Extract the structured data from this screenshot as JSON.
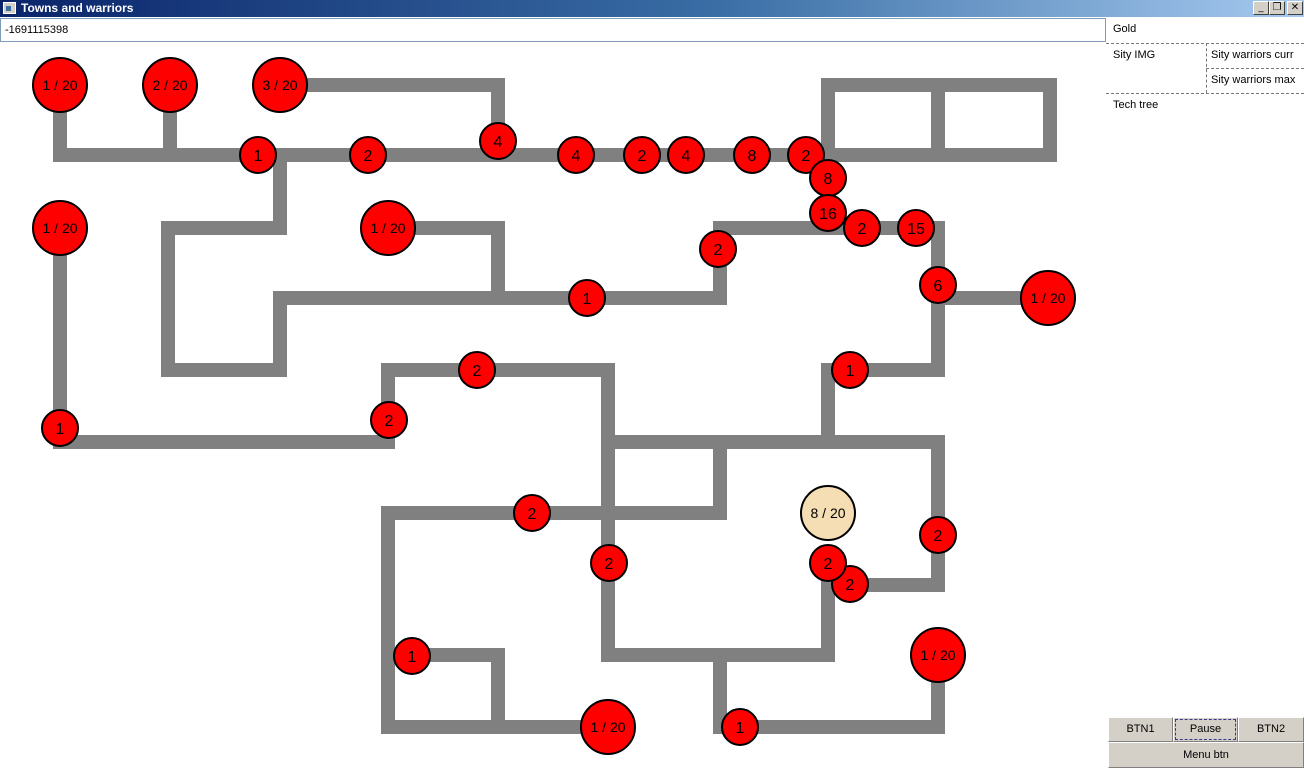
{
  "window": {
    "title": "Towns and warriors"
  },
  "seed_field": {
    "value": "-1691115398"
  },
  "side_panel": {
    "gold_label": "Gold",
    "city_img_label": "Sity IMG",
    "warriors_curr_label": "Sity warriors curr",
    "warriors_max_label": "Sity warriors max",
    "tech_tree_label": "Tech tree",
    "buttons": {
      "btn1": "BTN1",
      "pause": "Pause",
      "btn2": "BTN2",
      "menu": "Menu btn"
    }
  },
  "colors": {
    "enemy": "#ff0000",
    "player": "#f5deb3",
    "road": "#808080"
  },
  "cities": [
    {
      "label": "1 / 20",
      "owner": "enemy"
    },
    {
      "label": "2 / 20",
      "owner": "enemy"
    },
    {
      "label": "3 / 20",
      "owner": "enemy"
    },
    {
      "label": "1 / 20",
      "owner": "enemy"
    },
    {
      "label": "1 / 20",
      "owner": "enemy"
    },
    {
      "label": "1 / 20",
      "owner": "enemy"
    },
    {
      "label": "8 / 20",
      "owner": "player"
    },
    {
      "label": "1 / 20",
      "owner": "enemy"
    },
    {
      "label": "1 / 20",
      "owner": "enemy"
    }
  ],
  "armies": [
    {
      "label": "1"
    },
    {
      "label": "2"
    },
    {
      "label": "4"
    },
    {
      "label": "4"
    },
    {
      "label": "2"
    },
    {
      "label": "4"
    },
    {
      "label": "8"
    },
    {
      "label": "2"
    },
    {
      "label": "8"
    },
    {
      "label": "16"
    },
    {
      "label": "2"
    },
    {
      "label": "15"
    },
    {
      "label": "2"
    },
    {
      "label": "1"
    },
    {
      "label": "6"
    },
    {
      "label": "1"
    },
    {
      "label": "2"
    },
    {
      "label": "2"
    },
    {
      "label": "1"
    },
    {
      "label": "2"
    },
    {
      "label": "2"
    },
    {
      "label": "2"
    },
    {
      "label": "2"
    },
    {
      "label": "2"
    },
    {
      "label": "1"
    },
    {
      "label": "1"
    }
  ]
}
